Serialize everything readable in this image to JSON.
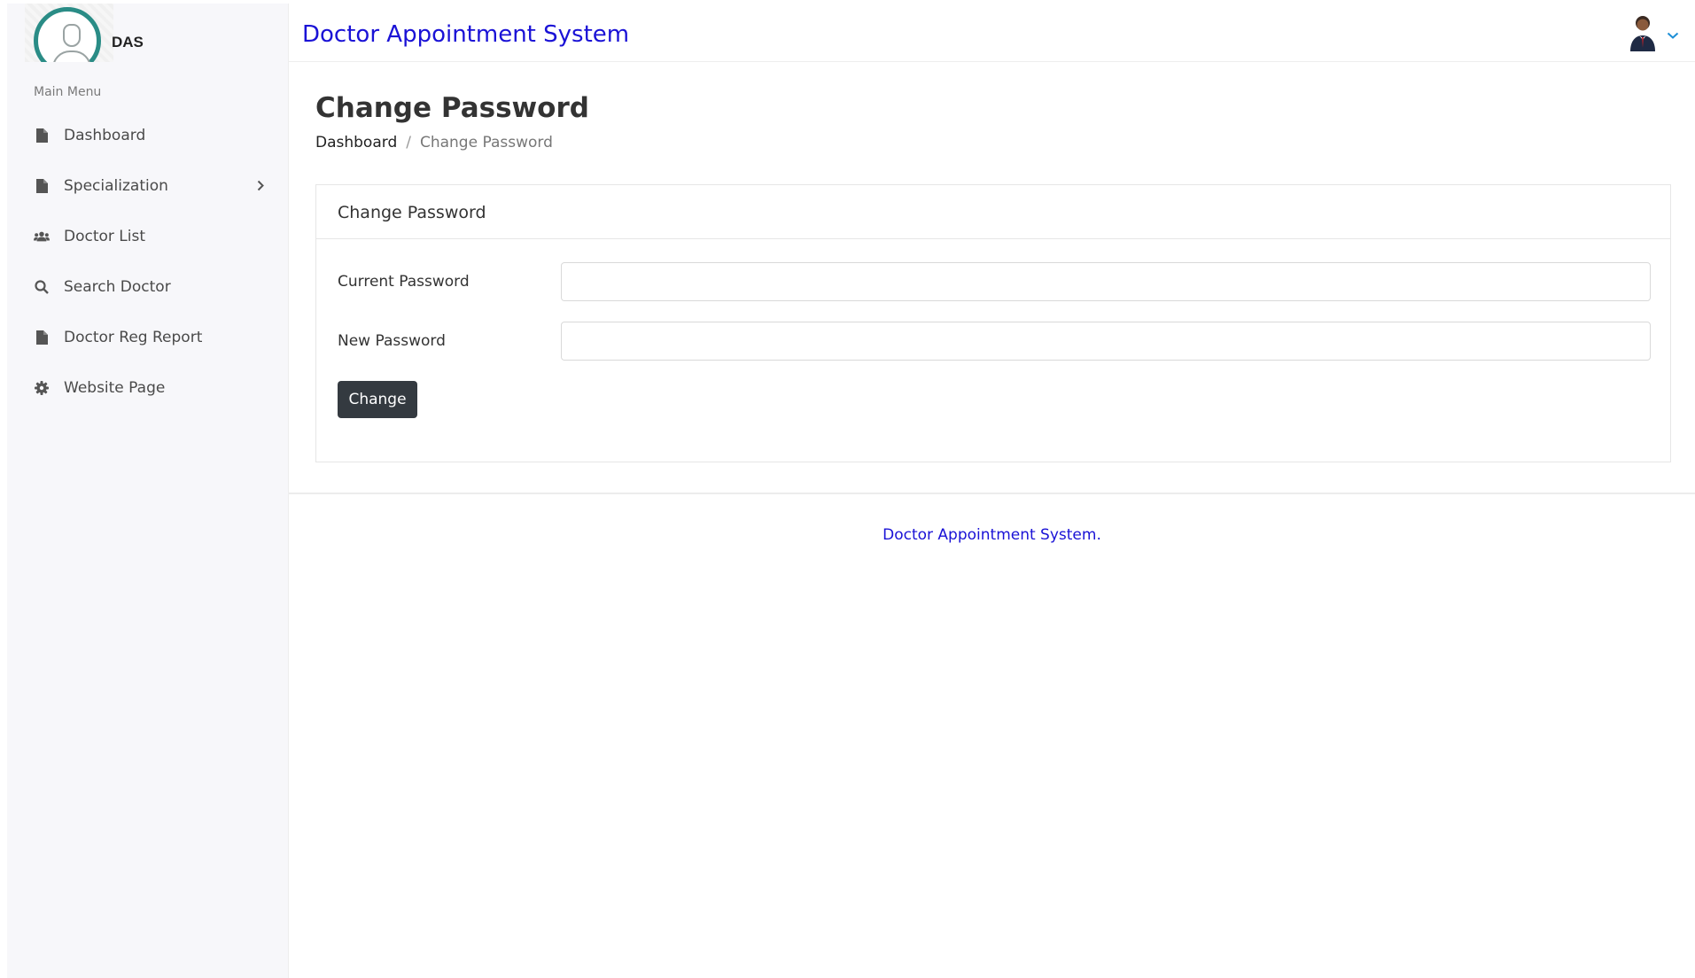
{
  "brand": {
    "name": "DAS"
  },
  "sidebar": {
    "section_label": "Main Menu",
    "items": [
      {
        "label": "Dashboard",
        "icon": "file-icon"
      },
      {
        "label": "Specialization",
        "icon": "file-icon",
        "has_submenu": true
      },
      {
        "label": "Doctor List",
        "icon": "users-icon"
      },
      {
        "label": "Search Doctor",
        "icon": "search-icon"
      },
      {
        "label": "Doctor Reg Report",
        "icon": "file-icon"
      },
      {
        "label": "Website Page",
        "icon": "gear-icon"
      }
    ]
  },
  "header": {
    "title": "Doctor Appointment System",
    "user_avatar_icon": "user-avatar",
    "accent_color": "#1a12d6"
  },
  "page": {
    "title": "Change Password",
    "breadcrumb": {
      "home": "Dashboard",
      "separator": "/",
      "current": "Change Password"
    }
  },
  "card": {
    "title": "Change Password",
    "fields": {
      "current_password": {
        "label": "Current Password",
        "value": "",
        "placeholder": ""
      },
      "new_password": {
        "label": "New Password",
        "value": "",
        "placeholder": ""
      }
    },
    "submit_label": "Change",
    "button_color": "#343a40"
  },
  "footer": {
    "text": "Doctor Appointment System."
  }
}
